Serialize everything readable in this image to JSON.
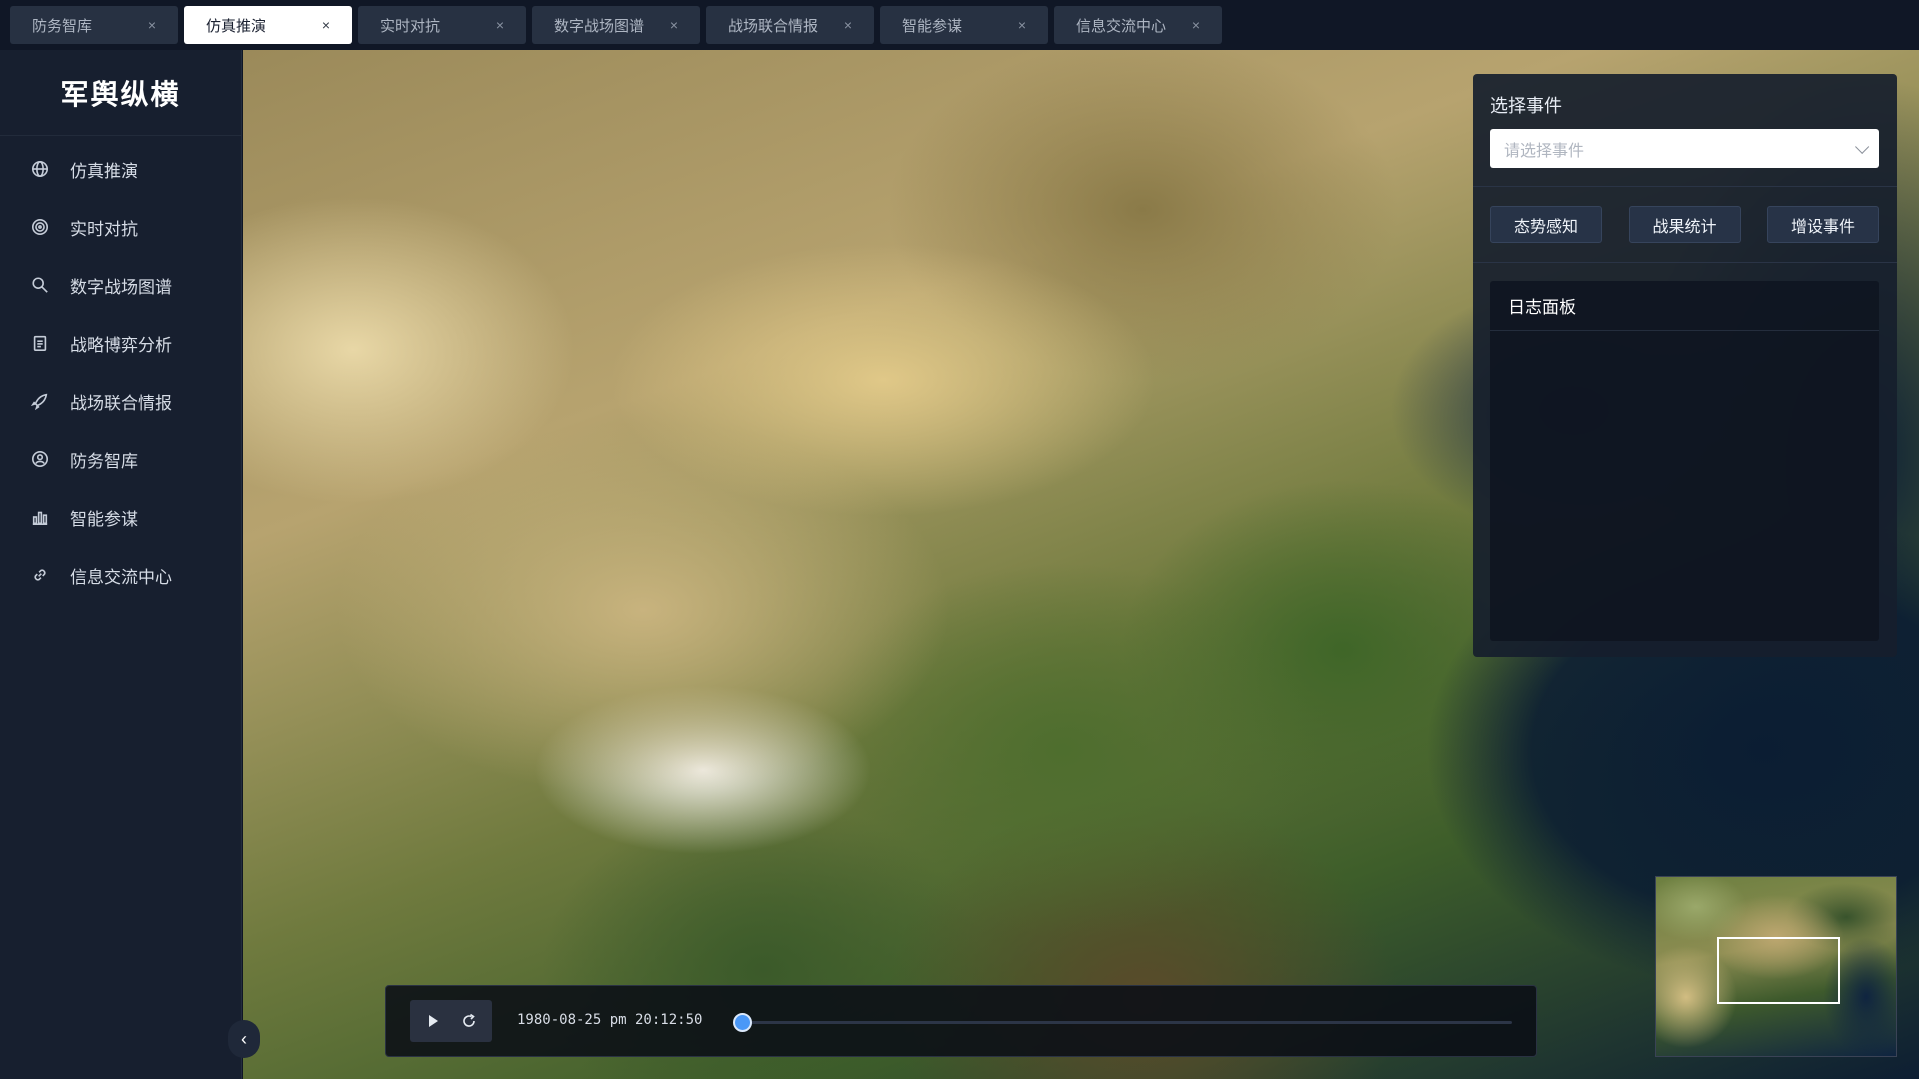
{
  "tabs": [
    {
      "label": "防务智库",
      "close": "×",
      "active": false
    },
    {
      "label": "仿真推演",
      "close": "×",
      "active": true
    },
    {
      "label": "实时对抗",
      "close": "×",
      "active": false
    },
    {
      "label": "数字战场图谱",
      "close": "×",
      "active": false
    },
    {
      "label": "战场联合情报",
      "close": "×",
      "active": false
    },
    {
      "label": "智能参谋",
      "close": "×",
      "active": false
    },
    {
      "label": "信息交流中心",
      "close": "×",
      "active": false
    }
  ],
  "sidebar": {
    "brand": "军舆纵横",
    "items": [
      {
        "label": "仿真推演",
        "icon": "globe-icon"
      },
      {
        "label": "实时对抗",
        "icon": "target-icon"
      },
      {
        "label": "数字战场图谱",
        "icon": "search-icon"
      },
      {
        "label": "战略博弈分析",
        "icon": "clipboard-icon"
      },
      {
        "label": "战场联合情报",
        "icon": "rocket-icon"
      },
      {
        "label": "防务智库",
        "icon": "user-shield-icon"
      },
      {
        "label": "智能参谋",
        "icon": "chart-icon"
      },
      {
        "label": "信息交流中心",
        "icon": "link-icon"
      }
    ],
    "collapse_glyph": "‹"
  },
  "event_panel": {
    "title": "选择事件",
    "select_placeholder": "请选择事件",
    "buttons": [
      "态势感知",
      "战果统计",
      "增设事件"
    ],
    "log_title": "日志面板"
  },
  "player": {
    "timestamp": "1980-08-25 pm 20:12:50",
    "progress": 0.0
  },
  "colors": {
    "accent": "#4a98f7",
    "tab_active_bg": "#ffffff",
    "sidebar_bg": "#171f2f"
  }
}
